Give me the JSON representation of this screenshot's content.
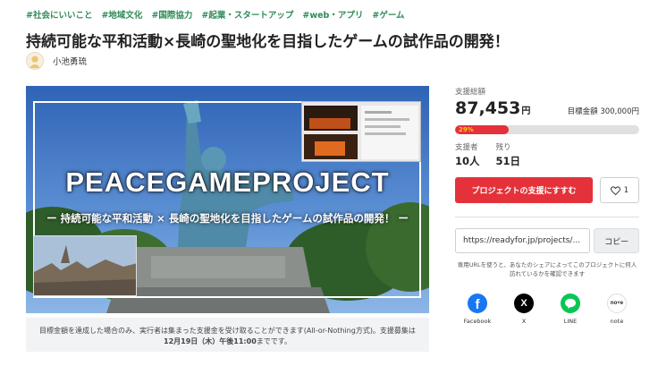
{
  "tags": [
    "#社会にいいこと",
    "#地域文化",
    "#国際協力",
    "#起業・スタートアップ",
    "#web・アプリ",
    "#ゲーム"
  ],
  "title": "持続可能な平和活動×長崎の聖地化を目指したゲームの試作品の開発！",
  "author": {
    "name": "小池勇琉"
  },
  "hero": {
    "headline": "PEACEGAMEPROJECT",
    "subheadline": "ー 持続可能な平和活動 × 長崎の聖地化を目指したゲームの試作品の開発！ ー"
  },
  "notice": {
    "text_prefix": "目標金額を達成した場合のみ、実行者は集まった支援金を受け取ることができます(All-or-Nothing方式)。支援募集は",
    "deadline": "12月19日（木）午後11:00",
    "text_suffix": "までです。"
  },
  "funding": {
    "total_label": "支援総額",
    "amount": "87,453",
    "unit": "円",
    "goal_text": "目標金額 300,000円",
    "progress_percent": 29,
    "progress_label": "29%",
    "supporters_label": "支援者",
    "supporters_value": "10人",
    "remaining_label": "残り",
    "remaining_value": "51日"
  },
  "actions": {
    "support_label": "プロジェクトの支援にすすむ",
    "like_count": "1"
  },
  "share": {
    "url": "https://readyfor.jp/projects/...",
    "copy_label": "コピー",
    "note": "専用URLを使うと、あなたのシェアによってこのプロジェクトに何人訪れているかを確認できます",
    "items": [
      {
        "label": "Facebook",
        "icon": "facebook-icon",
        "color": "#1877f2"
      },
      {
        "label": "X",
        "icon": "x-icon",
        "color": "#000000"
      },
      {
        "label": "LINE",
        "icon": "line-icon",
        "color": "#06c755"
      },
      {
        "label": "note",
        "icon": "note-icon",
        "color": "#ffffff"
      }
    ]
  }
}
